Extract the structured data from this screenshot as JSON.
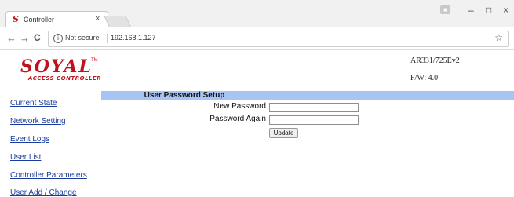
{
  "browser": {
    "tab_favicon": "S",
    "tab_title": "Controller",
    "tab_close": "×",
    "security_label": "Not secure",
    "url": "192.168.1.127",
    "back_glyph": "←",
    "forward_glyph": "→",
    "reload_glyph": "C",
    "info_glyph": "i",
    "star_glyph": "☆",
    "minimize_glyph": "–",
    "maximize_glyph": "□",
    "close_glyph": "×"
  },
  "brand": {
    "logo_word": "SOYAL",
    "logo_tm": "TM",
    "logo_subtitle": "ACCESS CONTROLLER",
    "logo_color": "#c0121b"
  },
  "device": {
    "model": "AR331/725Ev2",
    "firmware": "F/W: 4.0"
  },
  "sidebar": {
    "items": [
      {
        "label": "Current State"
      },
      {
        "label": "Network Setting"
      },
      {
        "label": "Event Logs"
      },
      {
        "label": "User List"
      },
      {
        "label": "Controller Parameters"
      },
      {
        "label": "User Add / Change"
      }
    ]
  },
  "form": {
    "title": "User Password Setup",
    "header_color": "#a7c4f3",
    "new_password_label": "New Password",
    "new_password_value": "",
    "password_again_label": "Password Again",
    "password_again_value": "",
    "submit_label": "Update"
  },
  "colors": {
    "link": "#1a3c9e"
  }
}
